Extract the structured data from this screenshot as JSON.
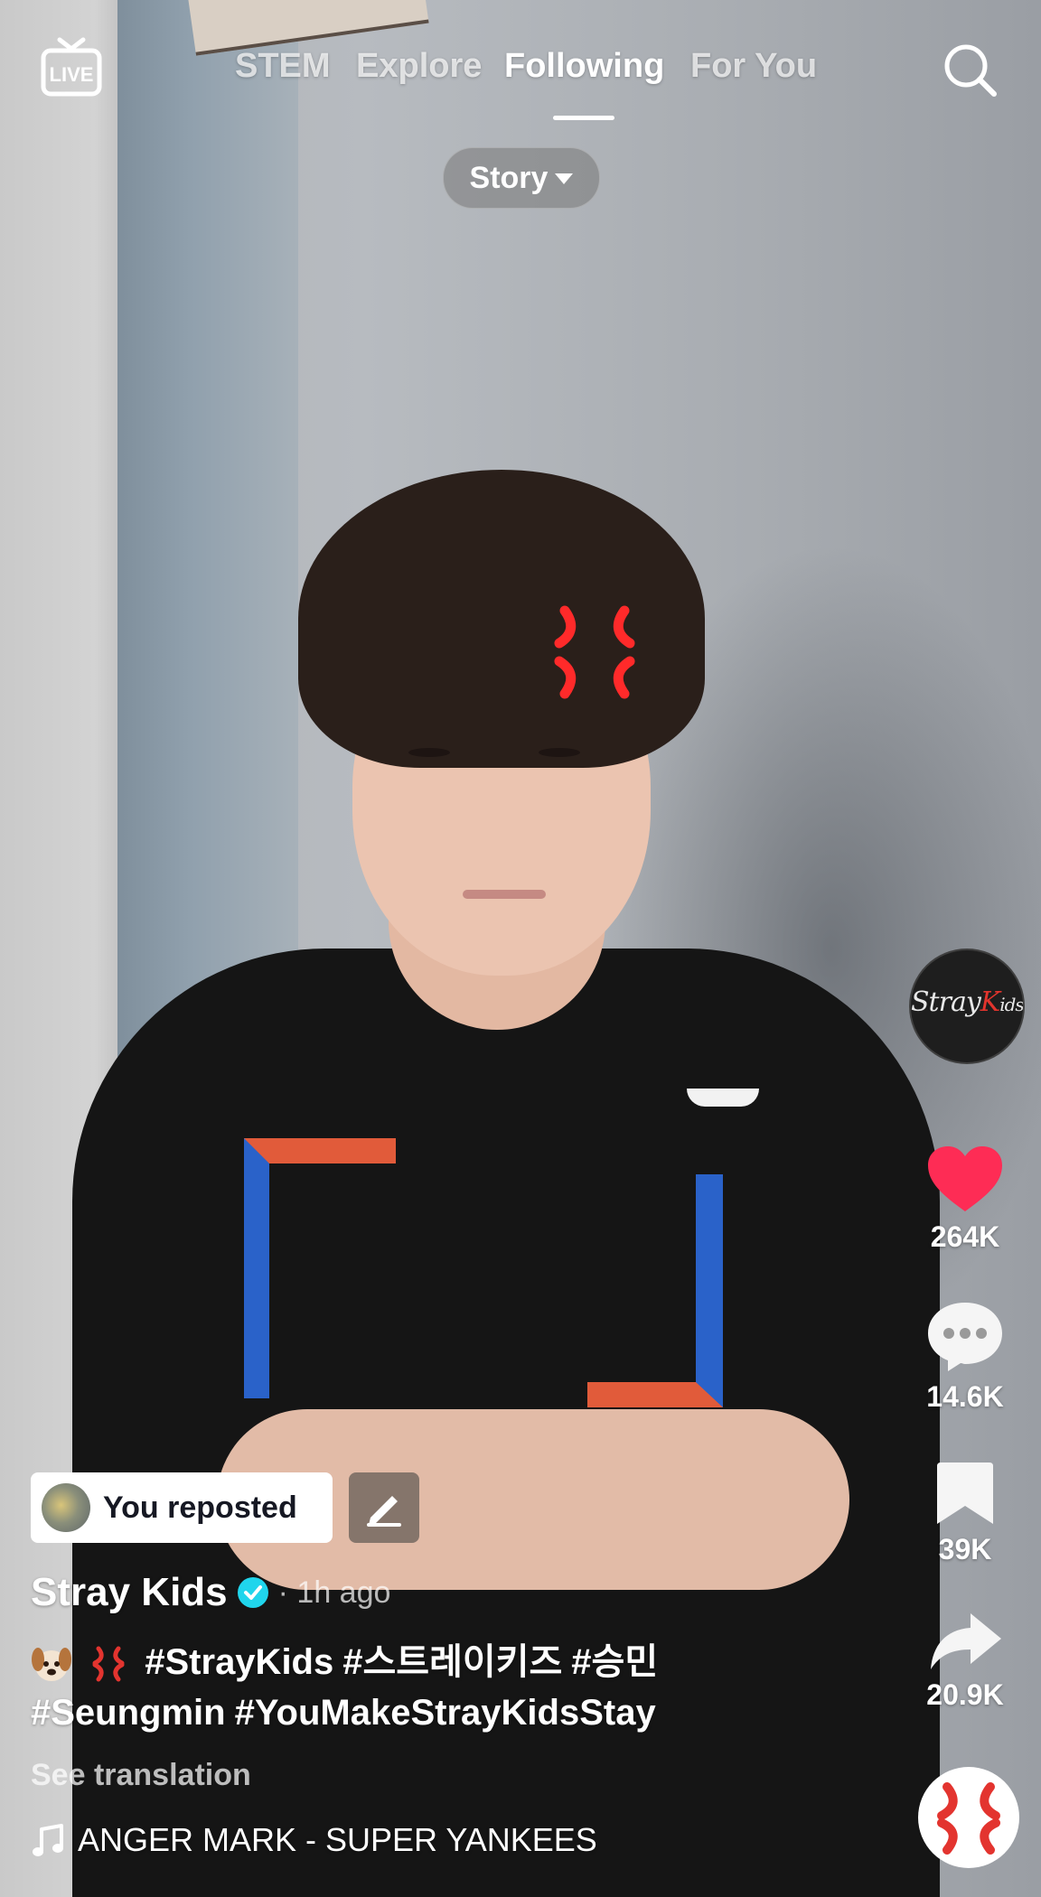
{
  "nav": {
    "live_label": "LIVE",
    "tabs": [
      {
        "label": "STEM",
        "active": false
      },
      {
        "label": "Explore",
        "active": false
      },
      {
        "label": "Following",
        "active": true
      },
      {
        "label": "For You",
        "active": false
      }
    ],
    "search_icon": "search-icon"
  },
  "story_filter": {
    "label": "Story",
    "icon": "caret-down-icon"
  },
  "rail": {
    "avatar_logo": {
      "part1": "Stray",
      "part2": "K",
      "part3": "ids"
    },
    "likes": "264K",
    "comments": "14.6K",
    "saves": "39K",
    "shares": "20.9K",
    "sound_icon": "anger-mark-icon"
  },
  "repost": {
    "label": "You reposted",
    "edit_icon": "pencil-icon"
  },
  "post": {
    "author": "Stray Kids",
    "verified": true,
    "time_ago": "· 1h ago",
    "caption_emojis": [
      "dog-face-emoji",
      "anger-emoji"
    ],
    "hashtags": [
      "#StrayKids",
      "#스트레이키즈",
      "#승민",
      "#Seungmin",
      "#YouMakeStrayKidsStay"
    ],
    "see_translation": "See translation",
    "music": "ANGER MARK - SUPER YANKEES"
  },
  "colors": {
    "like_red": "#FE2C55",
    "verified_blue": "#20D5EC",
    "anger_red": "#E3342F"
  }
}
